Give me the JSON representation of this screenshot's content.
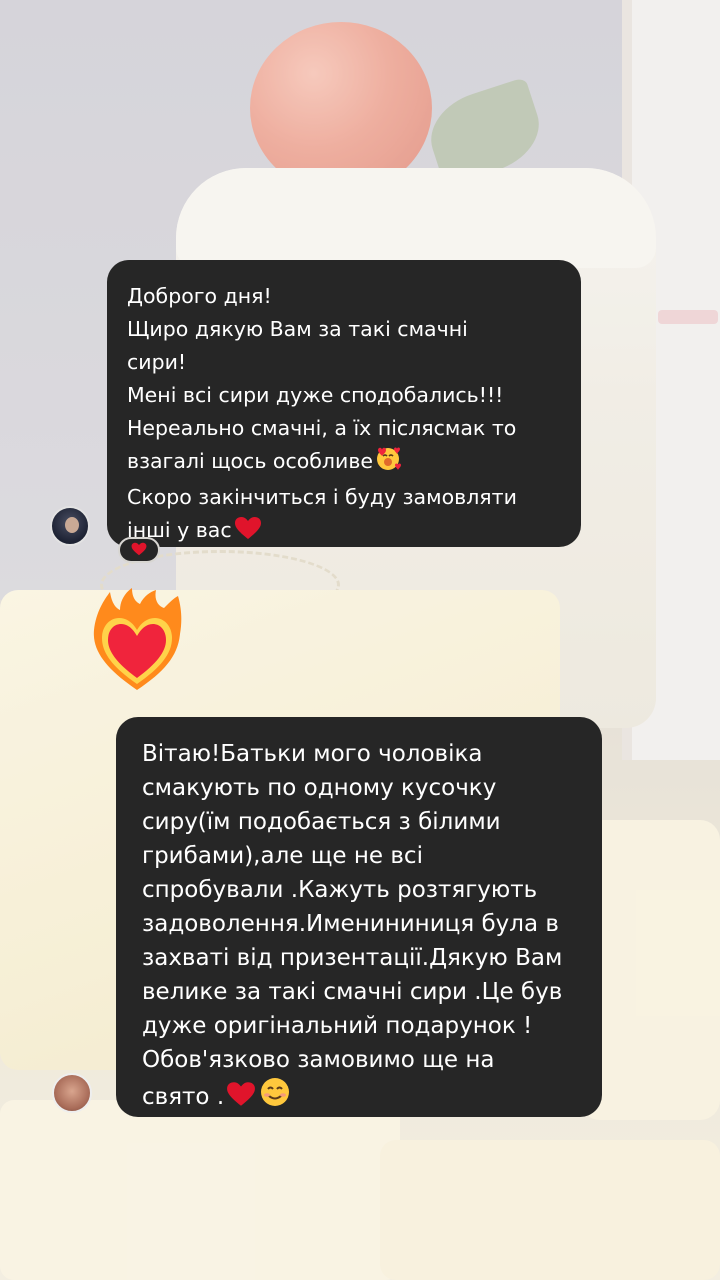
{
  "background": {
    "description_colors": {
      "tomato": "#e8907b",
      "cheese": "#f3e9c6",
      "wall": "#c6c4cc"
    }
  },
  "messages": [
    {
      "lines": [
        "Доброго дня!",
        "Щиро дякую Вам за такі смачні",
        "сири!",
        "Мені всі сири дуже сподобались!!!",
        "Нереально смачні,  а їх післясмак то",
        "взагалі щось особливе",
        "Скоро закінчиться і буду замовляти",
        "інші у вас"
      ],
      "emoji_smiling_hearts": "smiling-face-with-hearts-icon",
      "emoji_heart": "red-heart-icon",
      "reaction": "red-heart-icon"
    },
    {
      "lines": [
        "Вітаю!Батьки мого чоловіка",
        "смакують по одному кусочку",
        "сиру(їм подобається з білими",
        "грибами),але ще не всі",
        "спробували .Кажуть розтягують",
        "задоволення.Именининиця була в",
        "захваті від призентації.Дякую Вам",
        "велике за такі смачні сири .Це був",
        "дуже оригінальний подарунок !",
        "Обов'язково замовимо ще на",
        "свято ."
      ],
      "emoji_heart": "red-heart-icon",
      "emoji_smile": "smiling-face-icon"
    }
  ],
  "sticker": "heart-on-fire-icon",
  "colors": {
    "bubble": "#262626",
    "text": "#ffffff",
    "heart": "#e0142b"
  }
}
